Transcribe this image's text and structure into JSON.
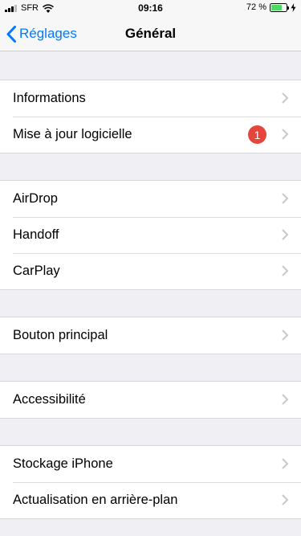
{
  "status_bar": {
    "carrier": "SFR",
    "time": "09:16",
    "battery_percent": "72 %",
    "battery_level": 0.72,
    "battery_color": "#4cd964",
    "signal_bars": 4,
    "signal_bars_filled": 3,
    "icons": [
      "signal-icon",
      "wifi-icon",
      "battery-icon",
      "charging-bolt-icon"
    ]
  },
  "nav": {
    "back_label": "Réglages",
    "title": "Général",
    "accent_color": "#007aff",
    "icons": [
      "chevron-left-icon"
    ]
  },
  "groups": [
    {
      "items": [
        {
          "label": "Informations"
        },
        {
          "label": "Mise à jour logicielle",
          "badge": "1"
        }
      ]
    },
    {
      "items": [
        {
          "label": "AirDrop"
        },
        {
          "label": "Handoff"
        },
        {
          "label": "CarPlay"
        }
      ]
    },
    {
      "items": [
        {
          "label": "Bouton principal"
        }
      ]
    },
    {
      "items": [
        {
          "label": "Accessibilité"
        }
      ]
    },
    {
      "items": [
        {
          "label": "Stockage iPhone"
        },
        {
          "label": "Actualisation en arrière-plan"
        }
      ]
    }
  ],
  "badge_color": "#e5453a",
  "row_icon": "chevron-right-icon"
}
